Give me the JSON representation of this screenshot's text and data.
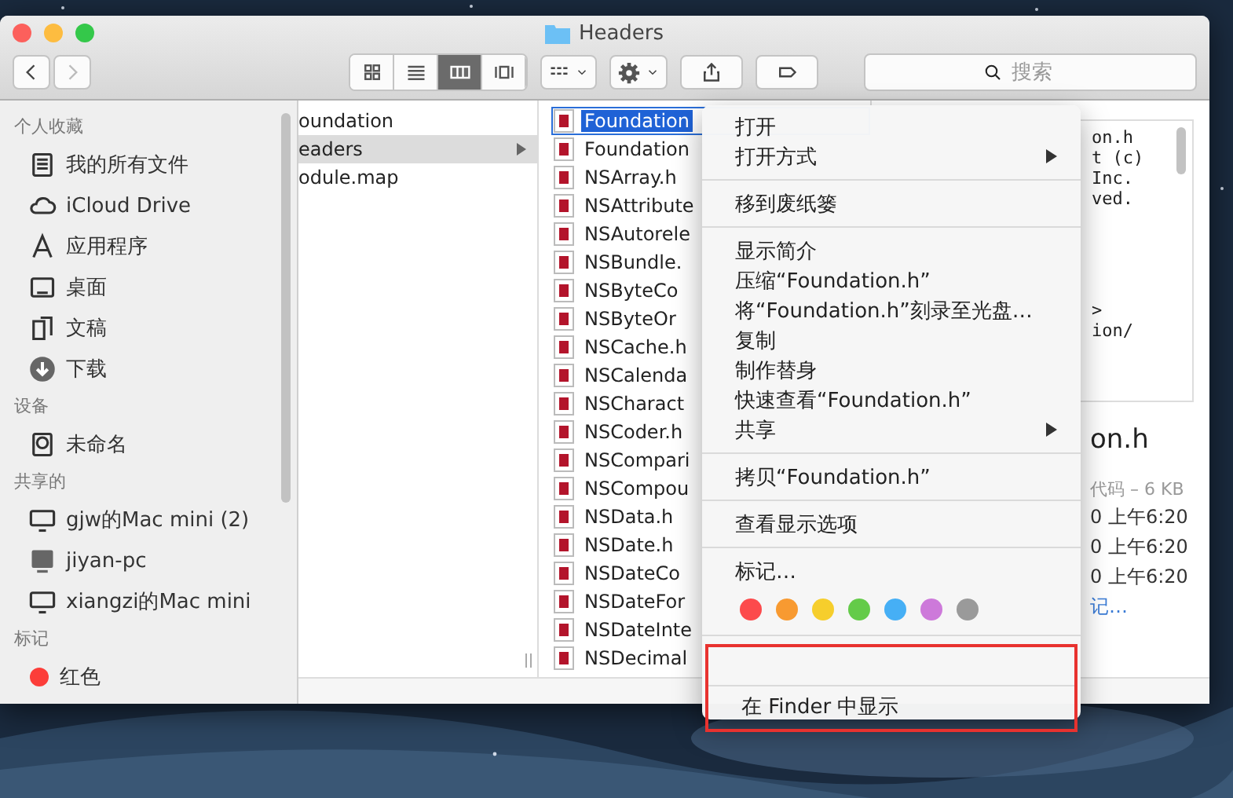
{
  "window": {
    "title": "Headers"
  },
  "toolbar": {
    "back": {
      "disabled": false
    },
    "forward": {
      "disabled": true
    },
    "views": [
      {
        "kind": "icons",
        "selected": false
      },
      {
        "kind": "list",
        "selected": false
      },
      {
        "kind": "columns",
        "selected": true
      },
      {
        "kind": "coverflow",
        "selected": false
      }
    ],
    "search": {
      "placeholder": "搜索"
    }
  },
  "sidebar": {
    "sections": [
      {
        "heading": "个人收藏",
        "items": [
          {
            "label": "我的所有文件",
            "kind": "allfiles"
          },
          {
            "label": "iCloud Drive",
            "kind": "cloud"
          },
          {
            "label": "应用程序",
            "kind": "apps"
          },
          {
            "label": "桌面",
            "kind": "desktop"
          },
          {
            "label": "文稿",
            "kind": "docs"
          },
          {
            "label": "下载",
            "kind": "download"
          }
        ]
      },
      {
        "heading": "设备",
        "items": [
          {
            "label": "未命名",
            "kind": "disk"
          }
        ]
      },
      {
        "heading": "共享的",
        "items": [
          {
            "label": "gjw的Mac mini (2)",
            "kind": "computer"
          },
          {
            "label": "jiyan-pc",
            "kind": "pc"
          },
          {
            "label": "xiangzi的Mac mini",
            "kind": "computer"
          }
        ]
      },
      {
        "heading": "标记",
        "items": [
          {
            "label": "红色",
            "kind": "tag",
            "color": "#fc3d39"
          }
        ]
      }
    ]
  },
  "columns": [
    {
      "items": [
        {
          "name": "oundation",
          "selected": false,
          "has_children": false
        },
        {
          "name": "eaders",
          "selected": true,
          "has_children": true
        },
        {
          "name": "odule.map",
          "selected": false,
          "has_children": false
        }
      ]
    },
    {
      "items": [
        {
          "name": "Foundation",
          "selected": true
        },
        {
          "name": "Foundation",
          "selected": false
        },
        {
          "name": "NSArray.h",
          "selected": false
        },
        {
          "name": "NSAttribute",
          "selected": false
        },
        {
          "name": "NSAutorele",
          "selected": false
        },
        {
          "name": "NSBundle.",
          "selected": false
        },
        {
          "name": "NSByteCo",
          "selected": false
        },
        {
          "name": "NSByteOr",
          "selected": false
        },
        {
          "name": "NSCache.h",
          "selected": false
        },
        {
          "name": "NSCalenda",
          "selected": false
        },
        {
          "name": "NSCharact",
          "selected": false
        },
        {
          "name": "NSCoder.h",
          "selected": false
        },
        {
          "name": "NSCompari",
          "selected": false
        },
        {
          "name": "NSCompou",
          "selected": false
        },
        {
          "name": "NSData.h",
          "selected": false
        },
        {
          "name": "NSDate.h",
          "selected": false
        },
        {
          "name": "NSDateCo",
          "selected": false
        },
        {
          "name": "NSDateFor",
          "selected": false
        },
        {
          "name": "NSDateInte",
          "selected": false
        },
        {
          "name": "NSDecimal",
          "selected": false
        }
      ]
    }
  ],
  "preview": {
    "code_blocks": [
      [
        "on.h",
        "t (c)",
        "Inc.",
        "ved."
      ],
      [
        ">",
        "ion/"
      ]
    ],
    "title": "on.h",
    "kind_size": "代码 – 6 KB",
    "dates": [
      "0 上午6:20",
      "0 上午6:20",
      "0 上午6:20"
    ],
    "link": "记…"
  },
  "context_menu": {
    "sections": [
      {
        "items": [
          {
            "label": "打开",
            "submenu": false
          },
          {
            "label": "打开方式",
            "submenu": true
          }
        ]
      },
      {
        "items": [
          {
            "label": "移到废纸篓",
            "submenu": false
          }
        ]
      },
      {
        "items": [
          {
            "label": "显示简介",
            "submenu": false
          },
          {
            "label": "压缩“Foundation.h”",
            "submenu": false
          },
          {
            "label": "将“Foundation.h”刻录至光盘…",
            "submenu": false
          },
          {
            "label": "复制",
            "submenu": false
          },
          {
            "label": "制作替身",
            "submenu": false
          },
          {
            "label": "快速查看“Foundation.h”",
            "submenu": false
          },
          {
            "label": "共享",
            "submenu": true
          }
        ]
      },
      {
        "items": [
          {
            "label": "拷贝“Foundation.h”",
            "submenu": false
          }
        ]
      },
      {
        "items": [
          {
            "label": "查看显示选项",
            "submenu": false
          }
        ]
      },
      {
        "items": [
          {
            "label": "标记…",
            "submenu": false
          }
        ],
        "tag_colors": [
          {
            "color": "#fc4a4c"
          },
          {
            "color": "#f89a31"
          },
          {
            "color": "#f6ce2c"
          },
          {
            "color": "#64cb49"
          },
          {
            "color": "#46aff5"
          },
          {
            "color": "#cd79da"
          },
          {
            "color": "#9a9a9a"
          }
        ]
      },
      {
        "items": [
          {
            "label": "在 Finder 中显示",
            "submenu": false
          }
        ]
      }
    ],
    "highlight_frame": true
  }
}
